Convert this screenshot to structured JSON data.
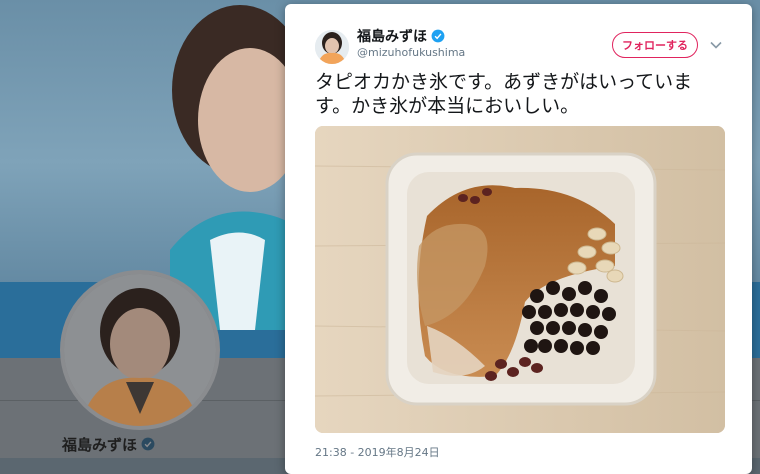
{
  "profile": {
    "name": "福島みずほ"
  },
  "tweet": {
    "author_name": "福島みずほ",
    "author_handle": "@mizuhofukushima",
    "follow_label": "フォローする",
    "text": "タピオカかき氷です。あずきがはいっています。かき氷が本当においしい。",
    "timestamp": "21:38 - 2019年8月24日",
    "photo_icon": "shaved-ice-photo",
    "menu_icon": "chevron-down-icon"
  },
  "colors": {
    "accent": "#e0245e",
    "verified": "#1da1f2",
    "text": "#14171a",
    "muted": "#657786"
  }
}
